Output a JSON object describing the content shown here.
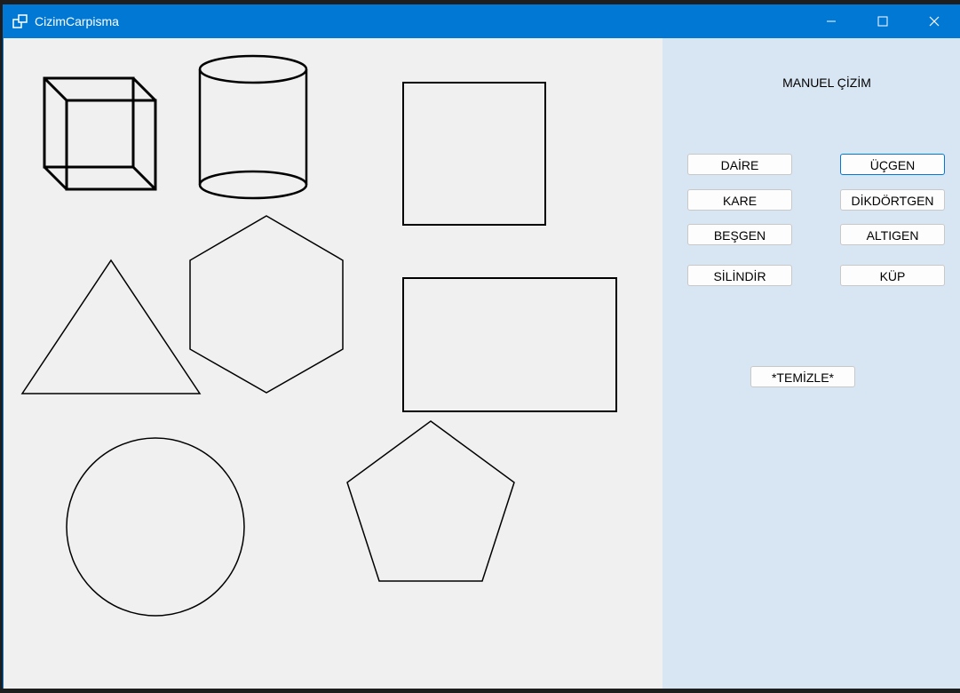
{
  "window": {
    "title": "CizimCarpisma",
    "controls": {
      "minimize": "minimize-icon",
      "maximize": "maximize-icon",
      "close": "close-icon"
    }
  },
  "panel": {
    "title": "MANUEL ÇİZİM",
    "buttons": {
      "daire": "DAİRE",
      "ucgen": "ÜÇGEN",
      "kare": "KARE",
      "dikdortgen": "DİKDÖRTGEN",
      "besgen": "BEŞGEN",
      "altigen": "ALTIGEN",
      "silindir": "SİLİNDİR",
      "kup": "KÜP",
      "temizle": "*TEMİZLE*"
    },
    "focused_button": "ucgen"
  },
  "canvas": {
    "shapes": [
      "cube",
      "cylinder",
      "square",
      "triangle",
      "hexagon",
      "rectangle",
      "circle",
      "pentagon"
    ]
  },
  "colors": {
    "titlebar": "#0078d4",
    "canvas_bg": "#f0f0f0",
    "panel_bg": "#d8e5f3",
    "stroke": "#000000"
  }
}
